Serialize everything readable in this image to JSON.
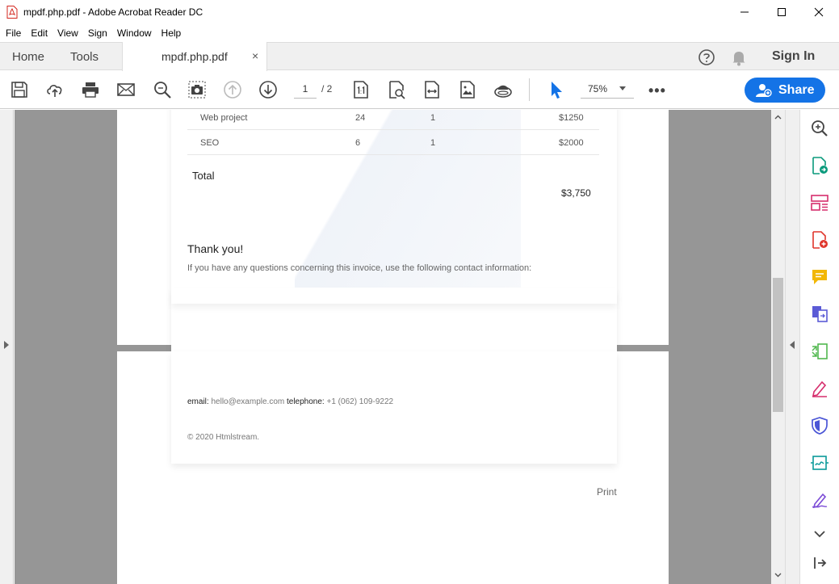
{
  "window": {
    "title": "mpdf.php.pdf - Adobe Acrobat Reader DC"
  },
  "menu": [
    "File",
    "Edit",
    "View",
    "Sign",
    "Window",
    "Help"
  ],
  "tabs": {
    "home": "Home",
    "tools": "Tools",
    "document": "mpdf.php.pdf",
    "close": "×",
    "sign_in": "Sign In"
  },
  "toolbar": {
    "page_current": "1",
    "page_total": "/ 2",
    "zoom": "75%",
    "more": "•••",
    "share_label": "Share"
  },
  "invoice": {
    "rows": [
      {
        "item": "Web project",
        "hours": "24",
        "qty": "1",
        "amount": "$1250"
      },
      {
        "item": "SEO",
        "hours": "6",
        "qty": "1",
        "amount": "$2000"
      }
    ],
    "total_label": "Total",
    "total_value": "$3,750",
    "thanks": "Thank you!",
    "questions": "If you have any questions concerning this invoice, use the following contact information:",
    "email_label": "email:",
    "email_value": "hello@example.com",
    "telephone_label": "telephone:",
    "telephone_value": "+1 (062) 109-9222",
    "copyright": "© 2020 Htmlstream.",
    "print": "Print"
  },
  "colors": {
    "accent": "#1473e6",
    "viewport_bg": "#969696"
  }
}
